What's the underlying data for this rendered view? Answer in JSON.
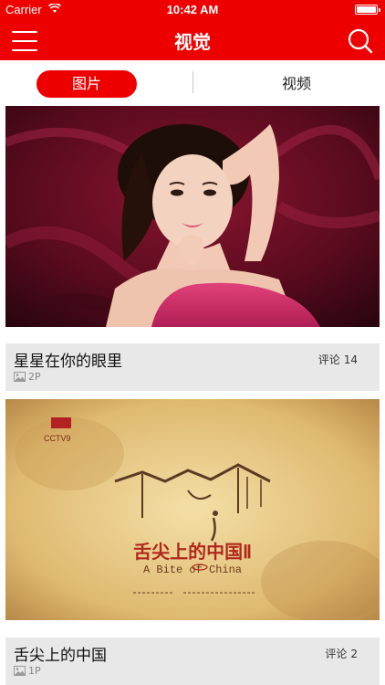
{
  "status_bar": {
    "carrier": "Carrier",
    "time": "10:42 AM"
  },
  "navbar": {
    "title": "视觉",
    "menu_icon": "hamburger-menu-icon",
    "search_icon": "search-icon"
  },
  "tabs": [
    {
      "label": "图片",
      "selected": true
    },
    {
      "label": "视频",
      "selected": false
    }
  ],
  "colors": {
    "accent": "#ee0000",
    "info_bg": "#e8e8e8"
  },
  "items": [
    {
      "title": "星星在你的眼里",
      "comment_label": "评论",
      "comment_count": "14",
      "photo_count": "2P"
    },
    {
      "title": "舌尖上的中国",
      "comment_label": "评论",
      "comment_count": "2",
      "photo_count": "1P",
      "image_text": {
        "cn_title": "舌尖上的中国Ⅱ",
        "en_title": "A Bite of China",
        "logo": "CCTV9"
      }
    }
  ]
}
